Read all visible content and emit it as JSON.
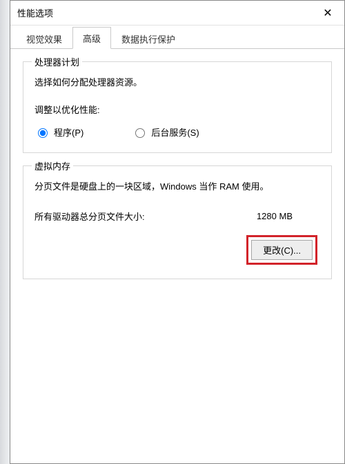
{
  "window": {
    "title": "性能选项",
    "close_glyph": "✕"
  },
  "tabs": {
    "visual": "视觉效果",
    "advanced": "高级",
    "dep": "数据执行保护"
  },
  "cpu": {
    "group_title": "处理器计划",
    "desc": "选择如何分配处理器资源。",
    "subhead": "调整以优化性能:",
    "opt_program": "程序(P)",
    "opt_background": "后台服务(S)"
  },
  "vm": {
    "group_title": "虚拟内存",
    "desc": "分页文件是硬盘上的一块区域，Windows 当作 RAM 使用。",
    "total_label": "所有驱动器总分页文件大小:",
    "total_value": "1280 MB",
    "change_btn": "更改(C)..."
  }
}
